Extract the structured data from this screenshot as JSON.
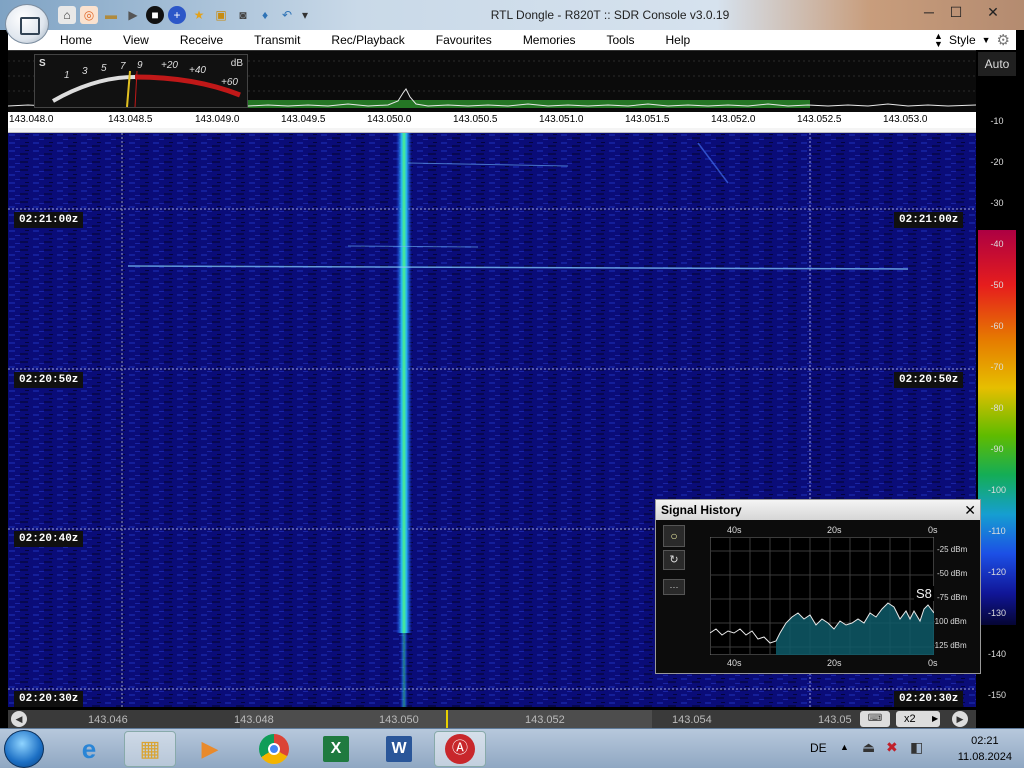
{
  "window": {
    "title": "RTL Dongle - R820T :: SDR Console v3.0.19",
    "minimize": "─",
    "maximize": "☐",
    "close": "✕"
  },
  "menu": {
    "items": [
      "Home",
      "View",
      "Receive",
      "Transmit",
      "Rec/Playback",
      "Favourites",
      "Memories",
      "Tools",
      "Help"
    ],
    "style_label": "Style"
  },
  "meter": {
    "s_label": "S",
    "db_label": "dB",
    "scale": [
      "1",
      "3",
      "5",
      "7",
      "9",
      "+20",
      "+40",
      "+60"
    ]
  },
  "frequency_axis": {
    "labels": [
      "143.048.0",
      "143.048.5",
      "143.049.0",
      "143.049.5",
      "143.050.0",
      "143.050.5",
      "143.051.0",
      "143.051.5",
      "143.052.0",
      "143.052.5",
      "143.053.0"
    ]
  },
  "waterfall": {
    "times": [
      "02:21:00z",
      "02:20:50z",
      "02:20:40z",
      "02:20:30z"
    ],
    "signal_frequency": "143.050.0"
  },
  "color_scale": {
    "auto_label": "Auto",
    "labels": [
      "-10",
      "-20",
      "-30",
      "-40",
      "-50",
      "-60",
      "-70",
      "-80",
      "-90",
      "-100",
      "-110",
      "-120",
      "-130",
      "-140",
      "-150"
    ]
  },
  "bottom_axis": {
    "labels": [
      "143.046",
      "143.048",
      "143.050",
      "143.052",
      "143.054",
      "143.05"
    ],
    "zoom_label": "x2"
  },
  "signal_history": {
    "title": "Signal History",
    "close": "✕",
    "top_ticks": [
      "40s",
      "20s",
      "0s"
    ],
    "bottom_ticks": [
      "40s",
      "20s",
      "0s"
    ],
    "dbm_labels": [
      "-25 dBm",
      "-50 dBm",
      "-75 dBm",
      "-100 dBm",
      "-125 dBm"
    ],
    "s_reading": "S8",
    "ctrl_labels": [
      "○",
      "↻",
      "···"
    ]
  },
  "taskbar": {
    "language": "DE",
    "time": "02:21",
    "date": "11.08.2024"
  },
  "colors": {
    "waterfall_bg": "#0a0c78",
    "signal": "#27e0a8",
    "accent": "#5ee070"
  }
}
